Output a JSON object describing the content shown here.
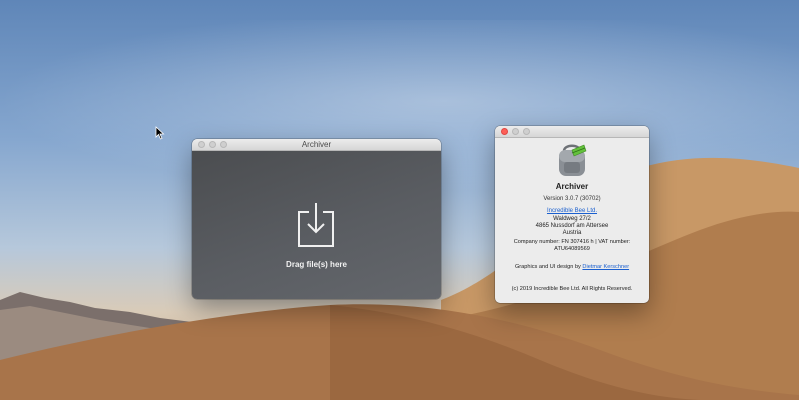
{
  "desktop": {
    "wallpaper": "mojave-desert-day"
  },
  "archiver_window": {
    "title": "Archiver",
    "drop_text": "Drag file(s) here",
    "drop_icon": "download-tray-icon"
  },
  "about_window": {
    "app_icon": "archiver-backpack-icon",
    "app_name": "Archiver",
    "version": "Version 3.0.7 (30702)",
    "company_link": "Incredible Bee Ltd.",
    "address": [
      "Waldweg 27/2",
      "4865 Nussdorf am Attersee",
      "Austria"
    ],
    "company_info": "Company number: FN 307416 h | VAT number: ATU64089569",
    "credits_prefix": "Graphics and UI design by ",
    "credits_link": "Dietmar Kerschner",
    "copyright": "(c) 2019 Incredible Bee Ltd. All Rights Reserved."
  },
  "colors": {
    "close_red": "#fe5f57",
    "link_blue": "#1a5fcf",
    "drop_area": "#55585c"
  }
}
